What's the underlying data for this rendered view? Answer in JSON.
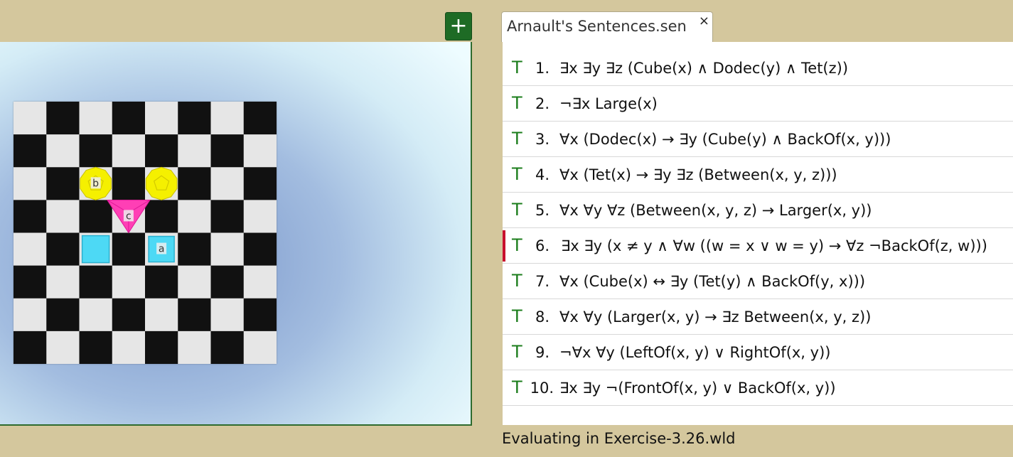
{
  "world": {
    "add_button_label": "+",
    "board": {
      "rows": 8,
      "cols": 8
    },
    "objects": [
      {
        "name": "b",
        "shape": "dodec",
        "size": "medium",
        "col": 2,
        "row": 2,
        "color": "#f5f000"
      },
      {
        "name": "",
        "shape": "dodec",
        "size": "medium",
        "col": 4,
        "row": 2,
        "color": "#f5f000"
      },
      {
        "name": "c",
        "shape": "tet",
        "size": "medium",
        "col": 3,
        "row": 3,
        "color": "#ff3fb5"
      },
      {
        "name": "",
        "shape": "cube",
        "size": "medium",
        "col": 2,
        "row": 4,
        "color": "#4dd9f5"
      },
      {
        "name": "a",
        "shape": "cube",
        "size": "small",
        "col": 4,
        "row": 4,
        "color": "#4dd9f5"
      }
    ]
  },
  "tab": {
    "title": "Arnault's Sentences.sen",
    "close_icon": "×"
  },
  "sentences": [
    {
      "truth": "T",
      "num": "1.",
      "text": "∃x ∃y ∃z (Cube(x) ∧ Dodec(y) ∧ Tet(z))",
      "selected": false
    },
    {
      "truth": "T",
      "num": "2.",
      "text": "¬∃x Large(x)",
      "selected": false
    },
    {
      "truth": "T",
      "num": "3.",
      "text": "∀x (Dodec(x) → ∃y (Cube(y) ∧ BackOf(x, y)))",
      "selected": false
    },
    {
      "truth": "T",
      "num": "4.",
      "text": "∀x (Tet(x) → ∃y ∃z (Between(x, y, z)))",
      "selected": false
    },
    {
      "truth": "T",
      "num": "5.",
      "text": "∀x ∀y ∀z (Between(x, y, z) → Larger(x, y))",
      "selected": false
    },
    {
      "truth": "T",
      "num": "6.",
      "text": "∃x ∃y (x ≠ y ∧ ∀w ((w = x ∨ w = y) → ∀z ¬BackOf(z, w)))",
      "selected": true
    },
    {
      "truth": "T",
      "num": "7.",
      "text": "∀x (Cube(x) ↔ ∃y (Tet(y) ∧ BackOf(y, x)))",
      "selected": false
    },
    {
      "truth": "T",
      "num": "8.",
      "text": "∀x ∀y (Larger(x, y) → ∃z Between(x, y, z))",
      "selected": false
    },
    {
      "truth": "T",
      "num": "9.",
      "text": "¬∀x ∀y (LeftOf(x, y) ∨ RightOf(x, y))",
      "selected": false
    },
    {
      "truth": "T",
      "num": "10.",
      "text": "∃x ∃y ¬(FrontOf(x, y) ∨ BackOf(x, y))",
      "selected": false
    }
  ],
  "status": "Evaluating in Exercise-3.26.wld",
  "colors": {
    "truth_true": "#1b7d1b",
    "selection_marker": "#c8102e",
    "background": "#d4c79d"
  }
}
